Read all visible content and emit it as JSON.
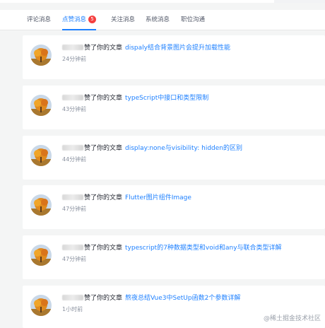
{
  "tabs": [
    {
      "label": "评论消息",
      "active": false
    },
    {
      "label": "点赞消息",
      "active": true,
      "badge": "5"
    },
    {
      "label": "关注消息",
      "active": false
    },
    {
      "label": "系统消息",
      "active": false
    },
    {
      "label": "职位沟通",
      "active": false
    }
  ],
  "notifications": [
    {
      "action": "赞了你的文章",
      "article": "dispaly结合背景图片会提升加载性能",
      "time": "24分钟前"
    },
    {
      "action": "赞了你的文章",
      "article": "typeScript中接口和类型限制",
      "time": "43分钟前"
    },
    {
      "action": "赞了你的文章",
      "article": "display:none与visibility: hidden的区别",
      "time": "44分钟前"
    },
    {
      "action": "赞了你的文章",
      "article": "Flutter图片组件Image",
      "time": "47分钟前"
    },
    {
      "action": "赞了你的文章",
      "article": "typescript的7种数据类型和void和any与联合类型详解",
      "time": "47分钟前"
    },
    {
      "action": "赞了你的文章",
      "article": "熬夜总结Vue3中SetUp函数2个参数详解",
      "time": "1小时前"
    }
  ],
  "watermark": "@稀土掘金技术社区",
  "colors": {
    "accent": "#1e80ff",
    "badge": "#f53f3f",
    "muted": "#8a919f"
  }
}
